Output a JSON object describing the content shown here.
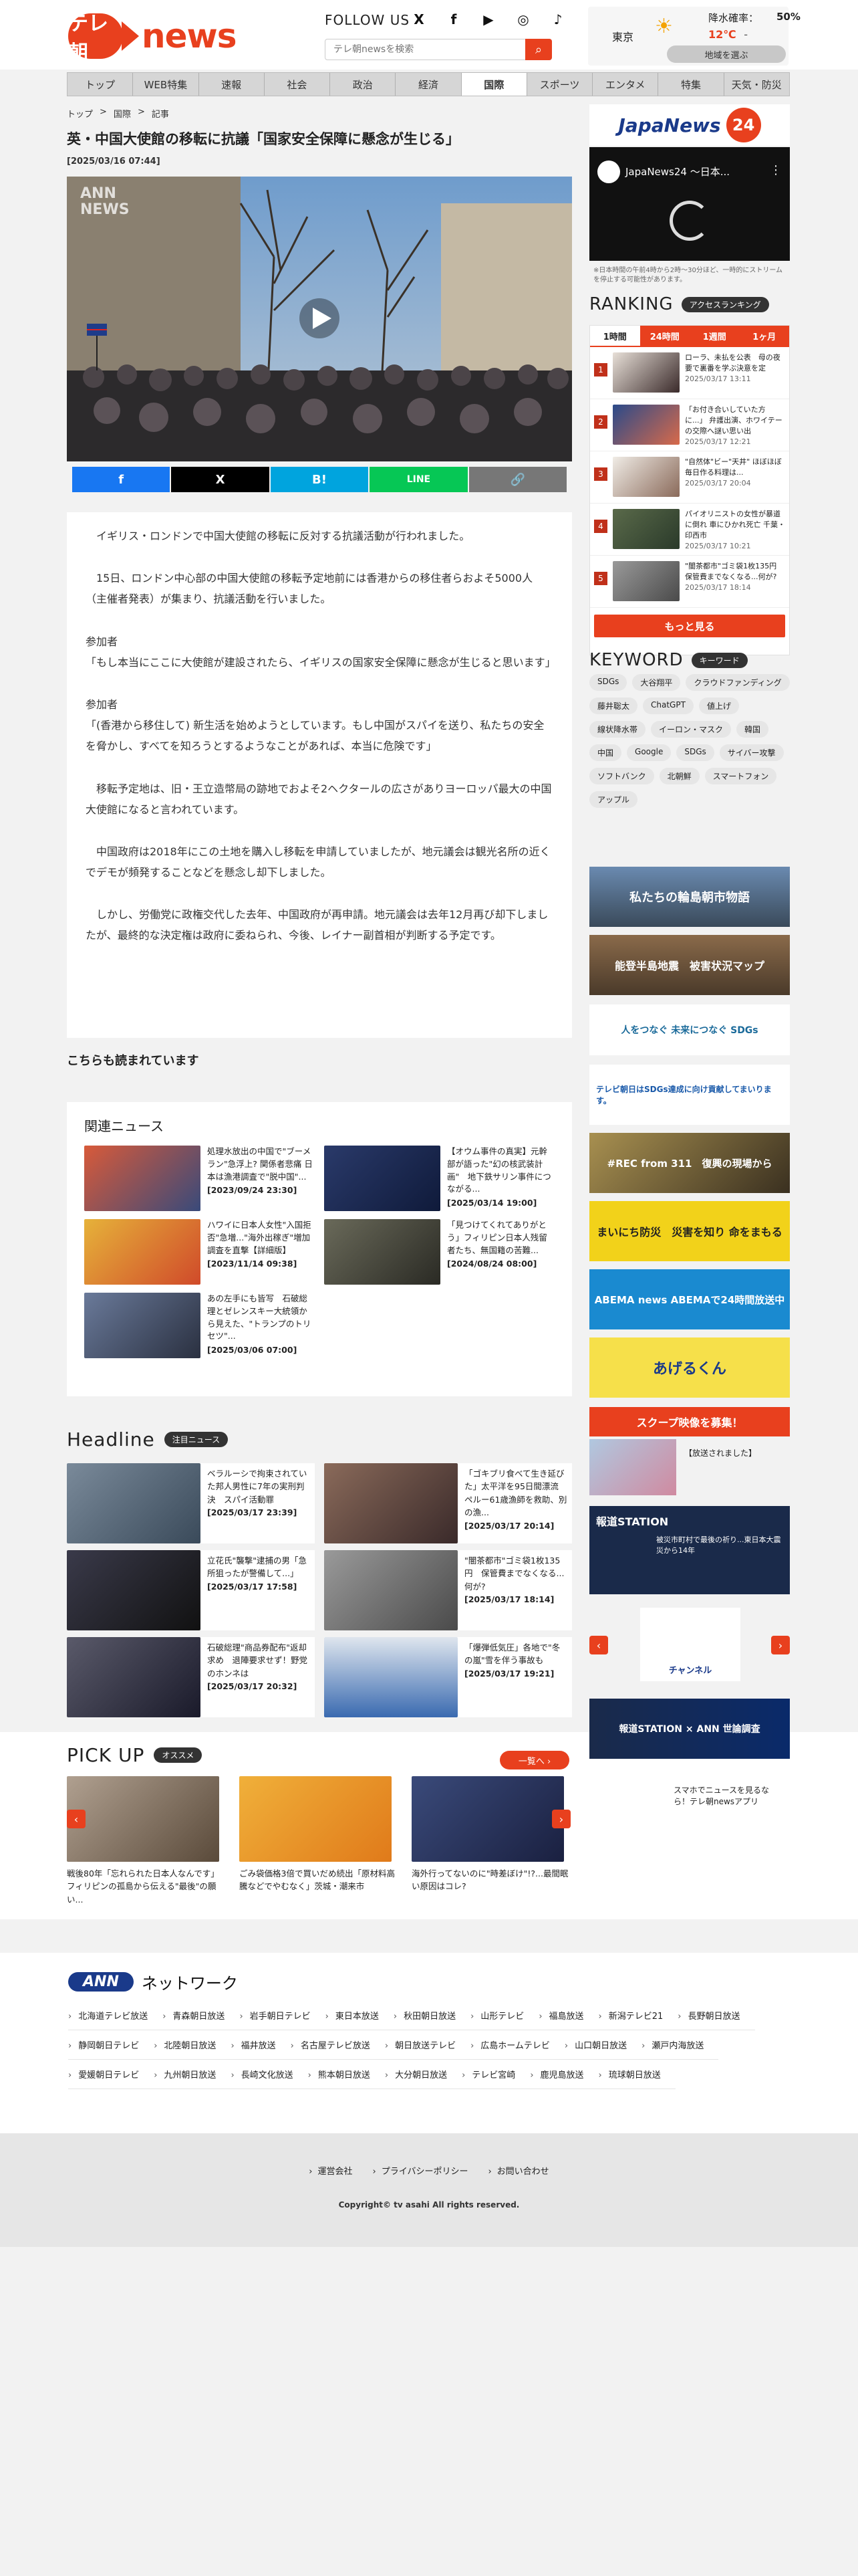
{
  "header": {
    "logo_badge": "テレ朝",
    "logo_text": "news",
    "follow_label": "FOLLOW US",
    "sns": [
      "X",
      "f",
      "▶",
      "◎",
      "♪"
    ],
    "search_placeholder": "テレ朝newsを検索",
    "weather": {
      "city": "東京",
      "rain_label": "降水確率：",
      "rain_value": "50%",
      "temp": "12℃",
      "temp_sep": "-",
      "region_button": "地域を選ぶ"
    }
  },
  "nav": [
    "トップ",
    "WEB特集",
    "速報",
    "社会",
    "政治",
    "経済",
    "国際",
    "スポーツ",
    "エンタメ",
    "特集",
    "天気・防災"
  ],
  "nav_active": "国際",
  "breadcrumb": [
    "トップ",
    ">",
    "国際",
    ">",
    "記事"
  ],
  "article": {
    "title": "英・中国大使館の移転に抗議「国家安全保障に懸念が生じる」",
    "date": "[2025/03/16 07:44]",
    "video_watermark": "ANN NEWS",
    "paragraphs": [
      "　イギリス・ロンドンで中国大使館の移転に反対する抗議活動が行われました。",
      "　15日、ロンドン中心部の中国大使館の移転予定地前には香港からの移住者らおよそ5000人（主催者発表）が集まり、抗議活動を行いました。",
      "参加者\n「もし本当にここに大使館が建設されたら、イギリスの国家安全保障に懸念が生じると思います」",
      "参加者\n「(香港から移住して) 新生活を始めようとしています。もし中国がスパイを送り、私たちの安全を脅かし、すべてを知ろうとするようなことがあれば、本当に危険です」",
      "　移転予定地は、旧・王立造幣局の跡地でおよそ2ヘクタールの広さがありヨーロッパ最大の中国大使館になると言われています。",
      "　中国政府は2018年にこの土地を購入し移転を申請していましたが、地元議会は観光名所の近くでデモが頻発することなどを懸念し却下しました。",
      "　しかし、労働党に政権交代した去年、中国政府が再申請。地元議会は去年12月再び却下しましたが、最終的な決定権は政府に委ねられ、今後、レイナー副首相が判断する予定です。"
    ],
    "share": [
      "f",
      "X",
      "B!",
      "LINE",
      "🔗"
    ]
  },
  "also_read": "こちらも読まれています",
  "related": {
    "title": "関連ニュース",
    "items": [
      {
        "text": "処理水放出の中国で\"ブーメラン\"急浮上? 関係者悲痛 日本は漁港調査で\"脱中国\"...",
        "date": "[2023/09/24 23:30]"
      },
      {
        "text": "【オウム事件の真実】元幹部が語った\"幻の核武装計画\"　地下鉄サリン事件につながる...",
        "date": "[2025/03/14 19:00]"
      },
      {
        "text": "ハワイに日本人女性\"入国拒否\"急増...\"海外出稼ぎ\"増加　調査を直撃【詳細版】",
        "date": "[2023/11/14 09:38]"
      },
      {
        "text": "「見つけてくれてありがとう」フィリピン日本人残留者たち、無国籍の苦難...",
        "date": "[2024/08/24 08:00]"
      },
      {
        "text": "あの左手にも皆写　石破総理とゼレンスキー大統領から見えた、\"トランプのトリセツ\"...",
        "date": "[2025/03/06 07:00]"
      }
    ]
  },
  "headline": {
    "title": "Headline",
    "badge": "注目ニュース",
    "items": [
      {
        "text": "ベラルーシで拘束されていた邦人男性に7年の実刑判決　スパイ活動罪",
        "date": "[2025/03/17 23:39]"
      },
      {
        "text": "「ゴキブリ食べて生き延びた」太平洋を95日間漂流　ペルー61歳漁師を救助、別の漁...",
        "date": "[2025/03/17 20:14]"
      },
      {
        "text": "立花氏\"襲撃\"逮捕の男「急所狙ったが警備して...」",
        "date": "[2025/03/17 17:58]"
      },
      {
        "text": "\"闇茶都市\"ゴミ袋1枚135円　保管費までなくなる...何が?",
        "date": "[2025/03/17 18:14]"
      },
      {
        "text": "石破総理\"商品券配布\"返却求め　退陣要求せず！野党のホンネは",
        "date": "[2025/03/17 20:32]"
      },
      {
        "text": "「爆弾低気圧」各地で\"冬の嵐\"雪を伴う事故も",
        "date": "[2025/03/17 19:21]"
      }
    ]
  },
  "pickup": {
    "title": "PICK UP",
    "badge": "オススメ",
    "more": "一覧へ ›",
    "items": [
      {
        "text": "戦後80年「忘れられた日本人なんです」フィリピンの孤島から伝える\"最後\"の願い..."
      },
      {
        "text": "ごみ袋価格3倍で買いだめ続出「原材料高騰などでやむなく」茨城・潮来市"
      },
      {
        "text": "海外行ってないのに\"時差ぼけ\"!?...最間眠い原因はコレ?"
      }
    ]
  },
  "sidebar": {
    "jn24_text": "JapaNews",
    "jn24_num": "24",
    "yt_title": "JapaNews24 ～日本...",
    "yt_note": "※日本時間の午前4時から2時～30分ほど、一時的にストリームを停止する可能性があります。",
    "ranking_title": "RANKING",
    "ranking_badge": "アクセスランキング",
    "ranking_tabs": [
      "1時間",
      "24時間",
      "1週間",
      "1ヶ月"
    ],
    "ranking": [
      {
        "num": "1",
        "text": "ローラ、未払を公表　母の夜要で裏番を学ぶ決意を定",
        "date": "2025/03/17 13:11"
      },
      {
        "num": "2",
        "text": "「お付き合いしていた方に...」 弁護出演、ホワイテーの交際へ謎い思い出",
        "date": "2025/03/17 12:21"
      },
      {
        "num": "3",
        "text": "\"自然体\"ビー\"天井\" ほぼほぼ毎日作る料理は...",
        "date": "2025/03/17 20:04"
      },
      {
        "num": "4",
        "text": "パイオリニストの女性が暴道に倒れ 車にひかれ死亡 千葉・印西市",
        "date": "2025/03/17 10:21"
      },
      {
        "num": "5",
        "text": "\"闇茶都市\"ゴミ袋1枚135円　保管費までなくなる...何が?",
        "date": "2025/03/17 18:14"
      }
    ],
    "ranking_more": "もっと見る",
    "keyword_title": "KEYWORD",
    "keyword_badge": "キーワード",
    "keywords": [
      "SDGs",
      "大谷翔平",
      "クラウドファンディング",
      "藤井聡太",
      "ChatGPT",
      "値上げ",
      "線状降水帯",
      "イーロン・マスク",
      "韓国",
      "中国",
      "Google",
      "SDGs",
      "サイバー攻撃",
      "ソフトバンク",
      "北朝鮮",
      "スマートフォン",
      "アップル"
    ],
    "banners": [
      "私たちの輪島朝市物語",
      "能登半島地震　被害状況マップ",
      "人をつなぐ 未来につなぐ SDGs",
      "テレビ朝日はSDGs達成に向け貢献してまいります。",
      "#REC from 311　復興の現場から",
      "まいにち防災　災害を知り 命をまもる",
      "ABEMA news ABEMAで24時間放送中",
      "あげるくん",
      "スクープ映像を募集！",
      "【放送されました】",
      "報道STATION",
      "被災市町村で最後の祈り...東日本大震災から14年",
      "チャンネル",
      "報道STATION × ANN 世論調査",
      "スマホでニュースを見るなら！テレ朝newsアプリ"
    ]
  },
  "network": {
    "logo": "ANN",
    "label": "ネットワーク",
    "stations": [
      "北海道テレビ放送",
      "青森朝日放送",
      "岩手朝日テレビ",
      "東日本放送",
      "秋田朝日放送",
      "山形テレビ",
      "福島放送",
      "新潟テレビ21",
      "長野朝日放送",
      "静岡朝日テレビ",
      "北陸朝日放送",
      "福井放送",
      "名古屋テレビ放送",
      "朝日放送テレビ",
      "広島ホームテレビ",
      "山口朝日放送",
      "瀬戸内海放送",
      "愛媛朝日テレビ",
      "九州朝日放送",
      "長崎文化放送",
      "熊本朝日放送",
      "大分朝日放送",
      "テレビ宮崎",
      "鹿児島放送",
      "琉球朝日放送"
    ]
  },
  "footer": {
    "links": [
      "運営会社",
      "プライバシーポリシー",
      "お問い合わせ"
    ],
    "copyright": "Copyright© tv asahi All rights reserved."
  },
  "colors": {
    "accent": "#e8401e",
    "ann_blue": "#1a3a8a",
    "facebook": "#1877f2",
    "x": "#000000",
    "hatena": "#00a4de",
    "line": "#06c755",
    "link": "#777777"
  }
}
